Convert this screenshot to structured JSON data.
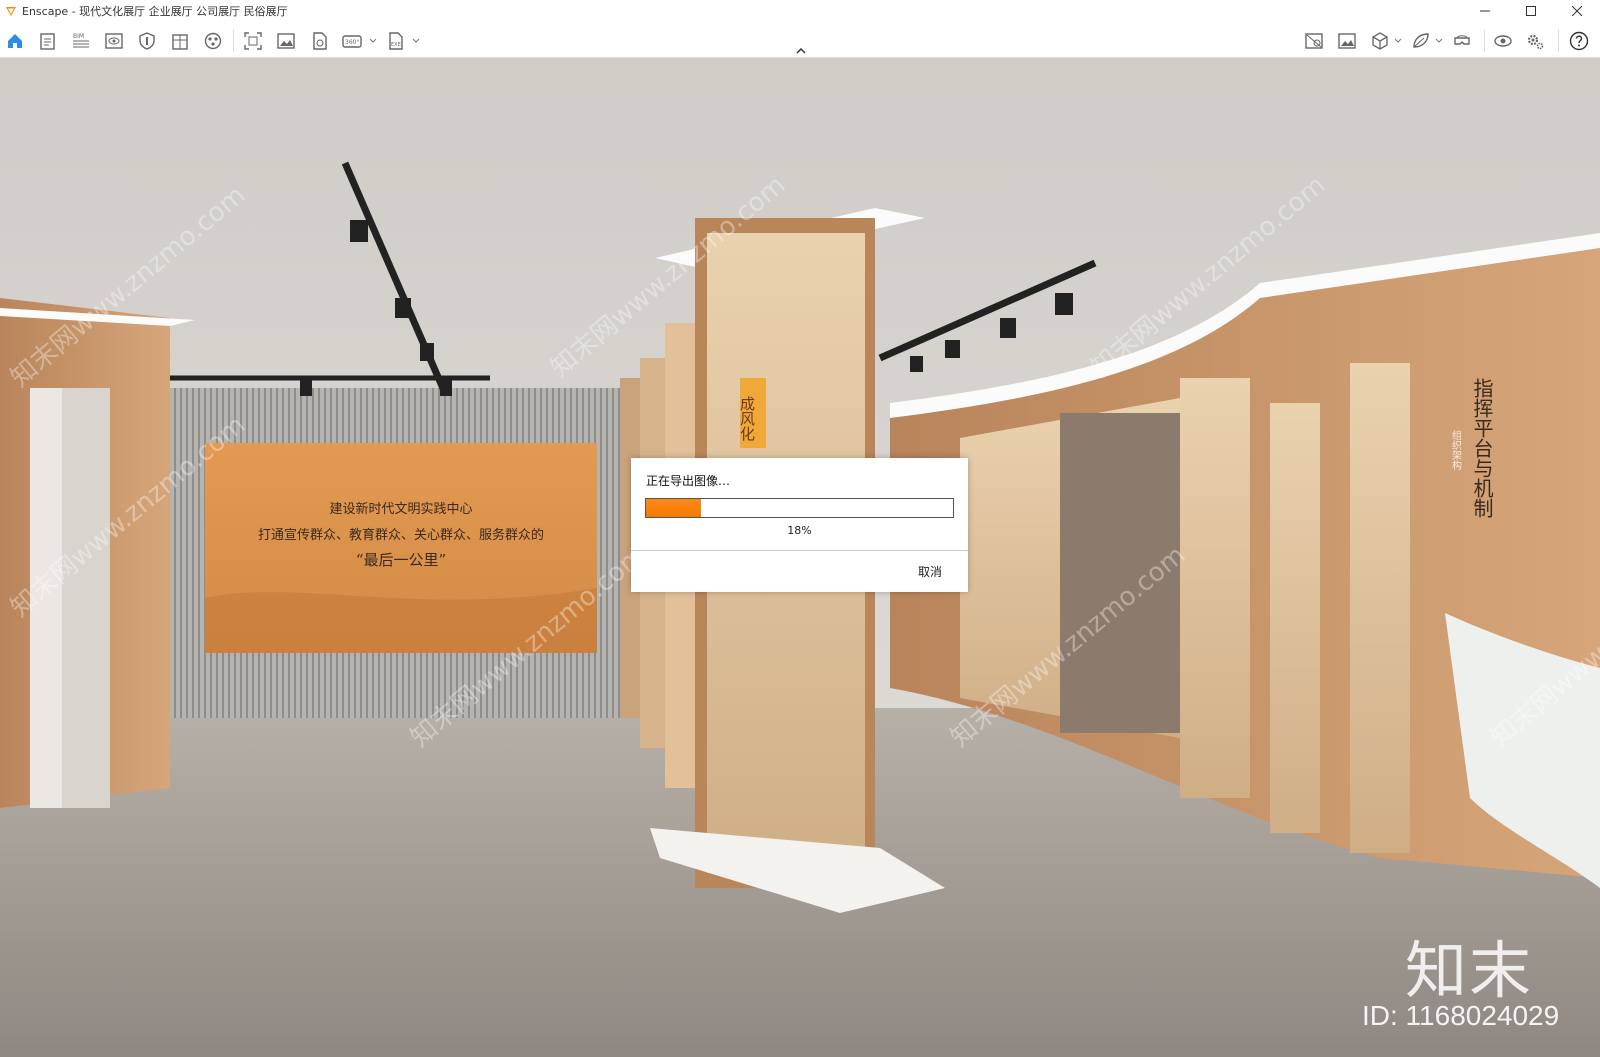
{
  "window": {
    "title": "Enscape - 现代文化展厅 企业展厅 公司展厅 民俗展厅",
    "controls": [
      "minimize",
      "maximize",
      "close"
    ]
  },
  "toolbar": {
    "left_icons": [
      "home-icon",
      "project-info-icon",
      "bim-icon",
      "visibility-icon",
      "settings-shield-icon",
      "building-icon",
      "material-sphere-icon",
      "screenshot-icon",
      "render-image-icon",
      "batch-render-icon",
      "panorama-360-icon",
      "export-exe-icon"
    ],
    "bim_label": "BIM",
    "pano_label": "360°",
    "exe_label": "EXE",
    "right_icons": [
      "view-management-icon",
      "image-gallery-icon",
      "asset-library-icon",
      "material-editor-icon",
      "vr-headset-icon",
      "visual-settings-icon",
      "gear-settings-icon",
      "help-icon"
    ]
  },
  "scene": {
    "sign_line1": "建设新时代文明实践中心",
    "sign_line2": "打通宣传群众、教育群众、关心群众、服务群众的",
    "sign_line3": "“最后一公里”",
    "wall_heading": "指挥平台与机制",
    "wall_plaque": "组织架构",
    "pillar_plaque": "成风化"
  },
  "dialog": {
    "title": "正在导出图像…",
    "progress": 0.18,
    "progress_label": "18%",
    "cancel_label": "取消",
    "progress_color": "#f47a00"
  },
  "watermark": {
    "brand": "知末",
    "id": "ID: 1168024029",
    "repeat": "知末网www.znzmo.com"
  }
}
